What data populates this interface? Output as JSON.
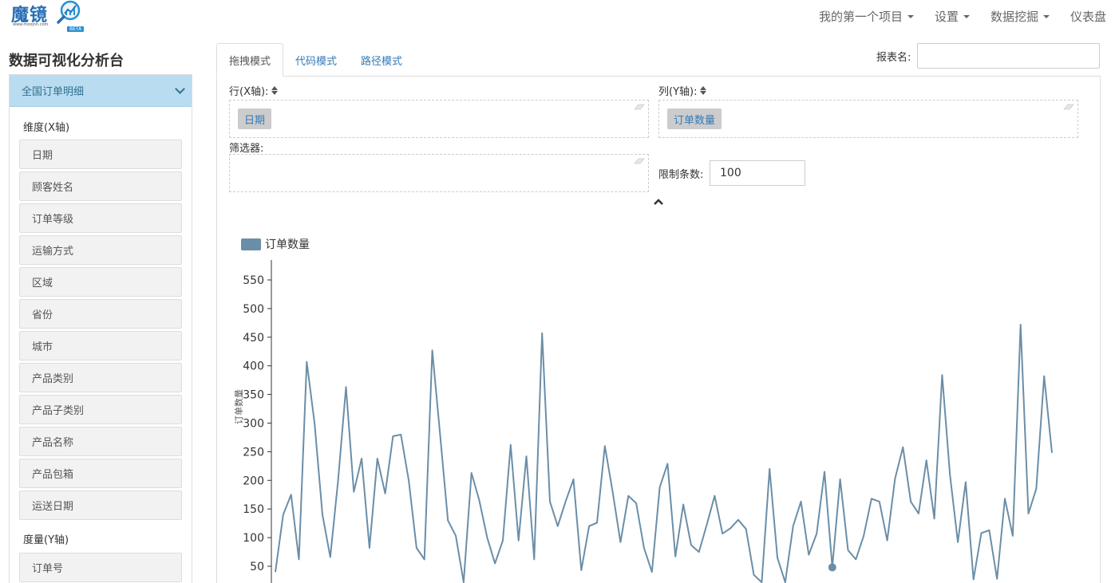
{
  "logo": {
    "text": "魔镜",
    "sub": "www.moojnn.com",
    "badge": "BETA"
  },
  "topnav": {
    "items": [
      {
        "label": "我的第一个项目",
        "dropdown": true
      },
      {
        "label": "设置",
        "dropdown": true
      },
      {
        "label": "数据挖掘",
        "dropdown": true
      },
      {
        "label": "仪表盘",
        "dropdown": false
      }
    ]
  },
  "sidebar": {
    "title": "数据可视化分析台",
    "dataset": "全国订单明细",
    "dimension_label": "维度(X轴)",
    "dimensions": [
      "日期",
      "顾客姓名",
      "订单等级",
      "运输方式",
      "区域",
      "省份",
      "城市",
      "产品类别",
      "产品子类别",
      "产品名称",
      "产品包箱",
      "运送日期"
    ],
    "measure_label": "度量(Y轴)",
    "measures": [
      "订单号"
    ]
  },
  "tabs": [
    {
      "label": "拖拽模式",
      "active": true
    },
    {
      "label": "代码模式",
      "active": false
    },
    {
      "label": "路径模式",
      "active": false
    }
  ],
  "report": {
    "label": "报表名:",
    "value": ""
  },
  "shelves": {
    "row_label": "行(X轴):",
    "row_pill": "日期",
    "col_label": "列(Y轴):",
    "col_pill": "订单数量",
    "filter_label": "筛选器:",
    "limit_label": "限制条数:",
    "limit_value": "100"
  },
  "colors": {
    "series": "#6b8ea8",
    "accent": "#337ab7",
    "sidebar_head": "#b9dcf0"
  },
  "chart_data": {
    "type": "line",
    "legend": [
      "订单数量"
    ],
    "ylabel": "订单数量",
    "yticks": [
      50,
      100,
      150,
      200,
      250,
      300,
      350,
      400,
      450,
      500,
      550
    ],
    "ylim": [
      20,
      570
    ],
    "series": [
      {
        "name": "订单数量",
        "values": [
          40,
          140,
          175,
          62,
          407,
          300,
          140,
          66,
          200,
          363,
          180,
          238,
          82,
          238,
          177,
          277,
          280,
          200,
          82,
          62,
          427,
          280,
          130,
          103,
          22,
          213,
          165,
          100,
          55,
          95,
          262,
          95,
          242,
          62,
          457,
          163,
          120,
          163,
          202,
          43,
          120,
          126,
          260,
          180,
          92,
          173,
          160,
          82,
          40,
          188,
          229,
          67,
          158,
          87,
          75,
          123,
          173,
          107,
          116,
          131,
          115,
          35,
          22,
          220,
          65,
          22,
          120,
          163,
          70,
          107,
          215,
          48,
          202,
          78,
          62,
          103,
          168,
          163,
          95,
          203,
          258,
          163,
          142,
          235,
          133,
          384,
          210,
          92,
          197,
          27,
          108,
          113,
          28,
          168,
          103,
          472,
          142,
          185,
          382,
          248
        ]
      }
    ],
    "highlight_index": 71
  }
}
